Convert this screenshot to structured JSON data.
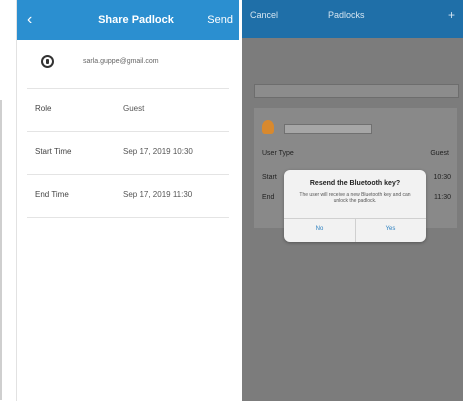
{
  "left": {
    "back_glyph": "‹",
    "title": "Share Padlock",
    "send_label": "Send",
    "email": "sarla.guppe@gmail.com",
    "rows": [
      {
        "label": "Role",
        "value": "Guest"
      },
      {
        "label": "Start Time",
        "value": "Sep 17, 2019 10:30"
      },
      {
        "label": "End Time",
        "value": "Sep 17, 2019 11:30"
      }
    ]
  },
  "right": {
    "cancel_label": "Cancel",
    "title": "Padlocks",
    "add_glyph": "+",
    "card": {
      "user_type_label": "User Type",
      "user_type_value": "Guest",
      "start_label": "Start",
      "end_label": "End",
      "start_value": "10:30",
      "end_value": "11:30"
    },
    "dialog": {
      "title": "Resend the Bluetooth key?",
      "body": "The user will receive a new Bluetooth key and can unlock the padlock.",
      "cancel_label": "No",
      "confirm_label": "Yes"
    }
  },
  "colors": {
    "blue_bar": "#2b8fd0",
    "overlay_bg": "#7c7c7c",
    "link": "#2a7fc0"
  }
}
